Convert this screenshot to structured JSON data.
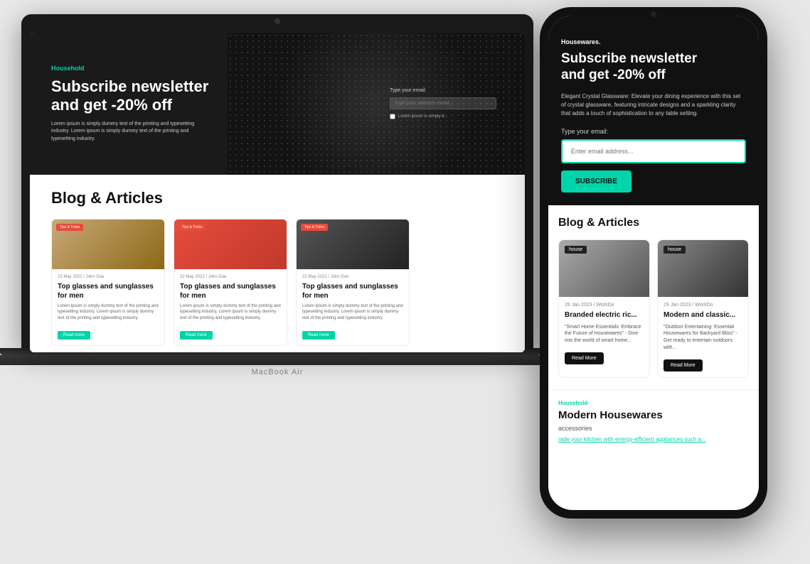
{
  "laptop": {
    "label": "MacBook Air",
    "hero": {
      "tag": "Household",
      "title": "Subscribe newsletter\nand get -20% off",
      "desc": "Lorem ipsum is simply dummy text of the printing and typesetting industry. Lorem ipsum is simply dummy text of the printing and typesetting industry.",
      "form_label": "Type your email:",
      "input_placeholder": "Type your address email...",
      "checkbox_label": "Lorem ipsum is simply d..."
    },
    "blog": {
      "title": "Blog & Articles",
      "cards": [
        {
          "tag": "Tips & Tricks",
          "meta": "22 May 2022 / John Doe",
          "title": "Top glasses and sunglasses for men",
          "text": "Lorem ipsum is simply dummy text of the printing and typesetting industry. Lorem ipsum is simply dummy text of the printing and typesetting industry.",
          "btn": "Read more"
        },
        {
          "tag": "Tips & Tricks",
          "meta": "22 May 2022 / John Doe",
          "title": "Top glasses and sunglasses for men",
          "text": "Lorem ipsum is simply dummy text of the printing and typesetting industry. Lorem ipsum is simply dummy text of the printing and typesetting industry.",
          "btn": "Read more"
        },
        {
          "tag": "Tips & Tricks",
          "meta": "22 May 2022 / John Doe",
          "title": "Top glasses and sunglasses for men",
          "text": "Lorem ipsum is simply dummy text of the printing and typesetting industry. Lorem ipsum is simply dummy text of the printing and typesetting industry.",
          "btn": "Read more"
        }
      ]
    }
  },
  "phone": {
    "brand": "Housewares.",
    "hero": {
      "title": "Subscribe newsletter\nand get -20% off",
      "desc": "Elegant Crystal Glassware: Elevate your dining experience with this set of crystal glassware, featuring intricate designs and a sparkling clarity that adds a touch of sophistication to any table setting.",
      "email_label": "Type your email:",
      "email_placeholder": "Enter email address...",
      "subscribe_btn": "SUBSCRIBE"
    },
    "blog": {
      "title": "Blog & Articles",
      "cards": [
        {
          "tag": "house",
          "meta": "29 Jan 2023 / WorkDo",
          "title": "Branded electric ric...",
          "desc": "\"Smart Home Essentials: Embrace the Future of Housewares\" - Dive into the world of smart home...",
          "btn": "Read More"
        },
        {
          "tag": "house",
          "meta": "29 Jan 2023 / WorkDo",
          "title": "Modern and classic...",
          "desc": "\"Outdoor Entertaining: Essential Housewares for Backyard Bliss\" - Get ready to entertain outdoors with...",
          "btn": "Read More"
        }
      ]
    },
    "footer": {
      "tag": "Household",
      "title": "Modern Housewares",
      "subtitle": "accessories",
      "desc": "rade your kitchen with energy-efficient appliances such a..."
    }
  }
}
